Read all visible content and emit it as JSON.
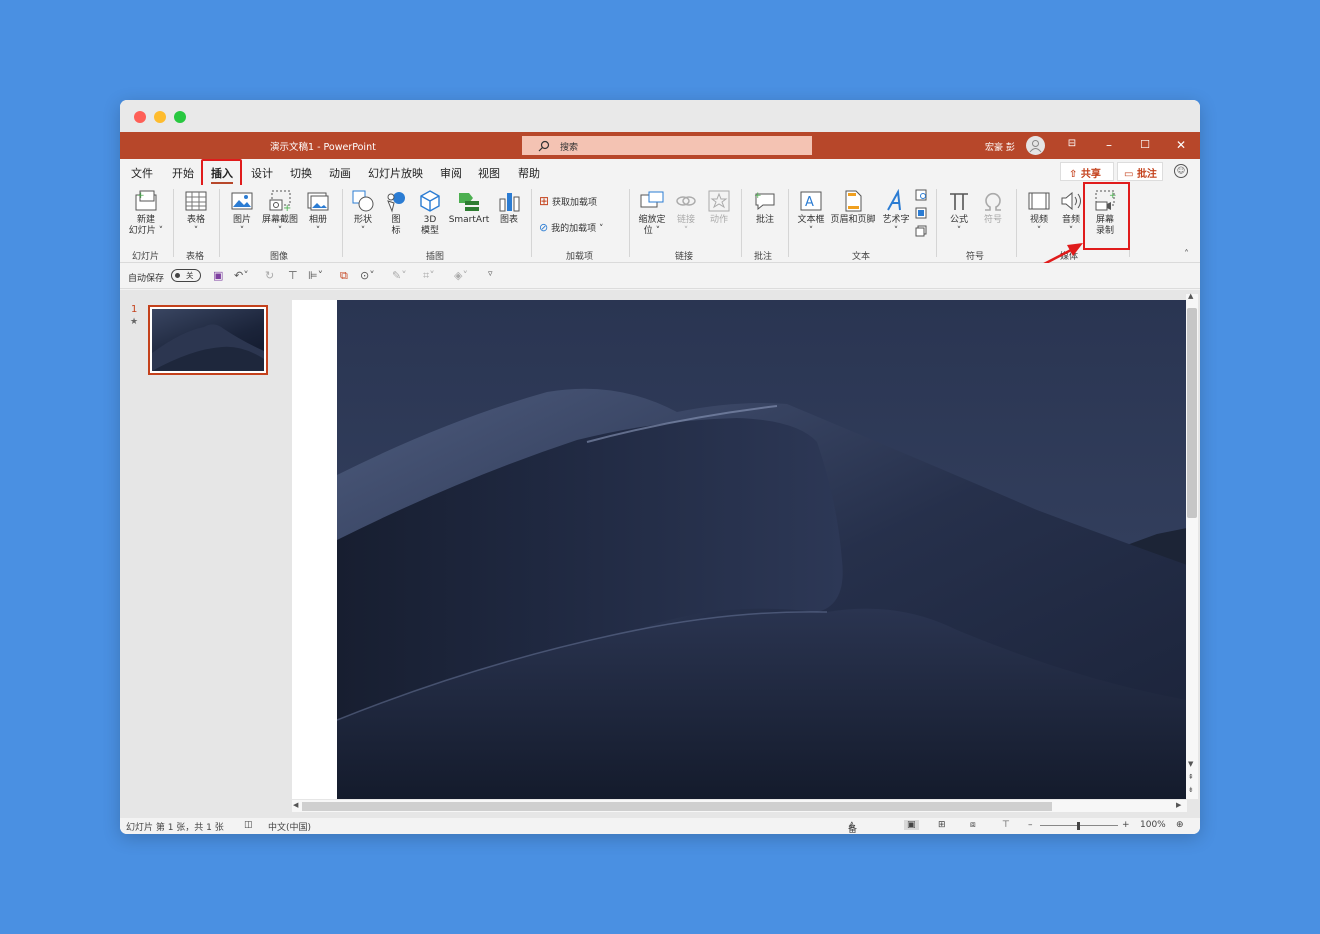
{
  "window": {
    "title": "演示文稿1  -  PowerPoint",
    "search_placeholder": "搜索",
    "user_name": "宏豪 彭"
  },
  "tabs": [
    "文件",
    "开始",
    "插入",
    "设计",
    "切换",
    "动画",
    "幻灯片放映",
    "审阅",
    "视图",
    "帮助"
  ],
  "active_tab": "插入",
  "share_label": "共享",
  "comments_label": "批注",
  "ribbon": {
    "new_slide": "新建\n幻灯片",
    "table": "表格",
    "pictures": "图片",
    "screenshot": "屏幕截图",
    "album": "相册",
    "shapes": "形状",
    "icons": "图\n标",
    "model3d": "3D\n模型",
    "smartart": "SmartArt",
    "chart": "图表",
    "get_addins": "获取加载项",
    "my_addins": "我的加载项",
    "zoom": "缩放定\n位",
    "link": "链接",
    "action": "动作",
    "comment": "批注",
    "textbox": "文本框",
    "header_footer": "页眉和页脚",
    "wordart": "艺术字",
    "equation": "公式",
    "symbol": "符号",
    "video": "视频",
    "audio": "音频",
    "screen_recording": "屏幕\n录制",
    "groups": {
      "slides": "幻灯片",
      "tables": "表格",
      "images": "图像",
      "illustrations": "插图",
      "addins": "加载项",
      "links": "链接",
      "comments": "批注",
      "text": "文本",
      "symbols": "符号",
      "media": "媒体"
    }
  },
  "qat": {
    "autosave": "自动保存",
    "toggle": "关"
  },
  "thumbnail": {
    "number": "1",
    "star": "★"
  },
  "status": {
    "slide_info": "幻灯片 第 1 张，共 1 张",
    "language": "中文(中国)",
    "notes": "备注",
    "zoom": "100%"
  },
  "colors": {
    "accent": "#b7472a",
    "highlight": "#e01b1b",
    "background": "#4a90e2"
  }
}
